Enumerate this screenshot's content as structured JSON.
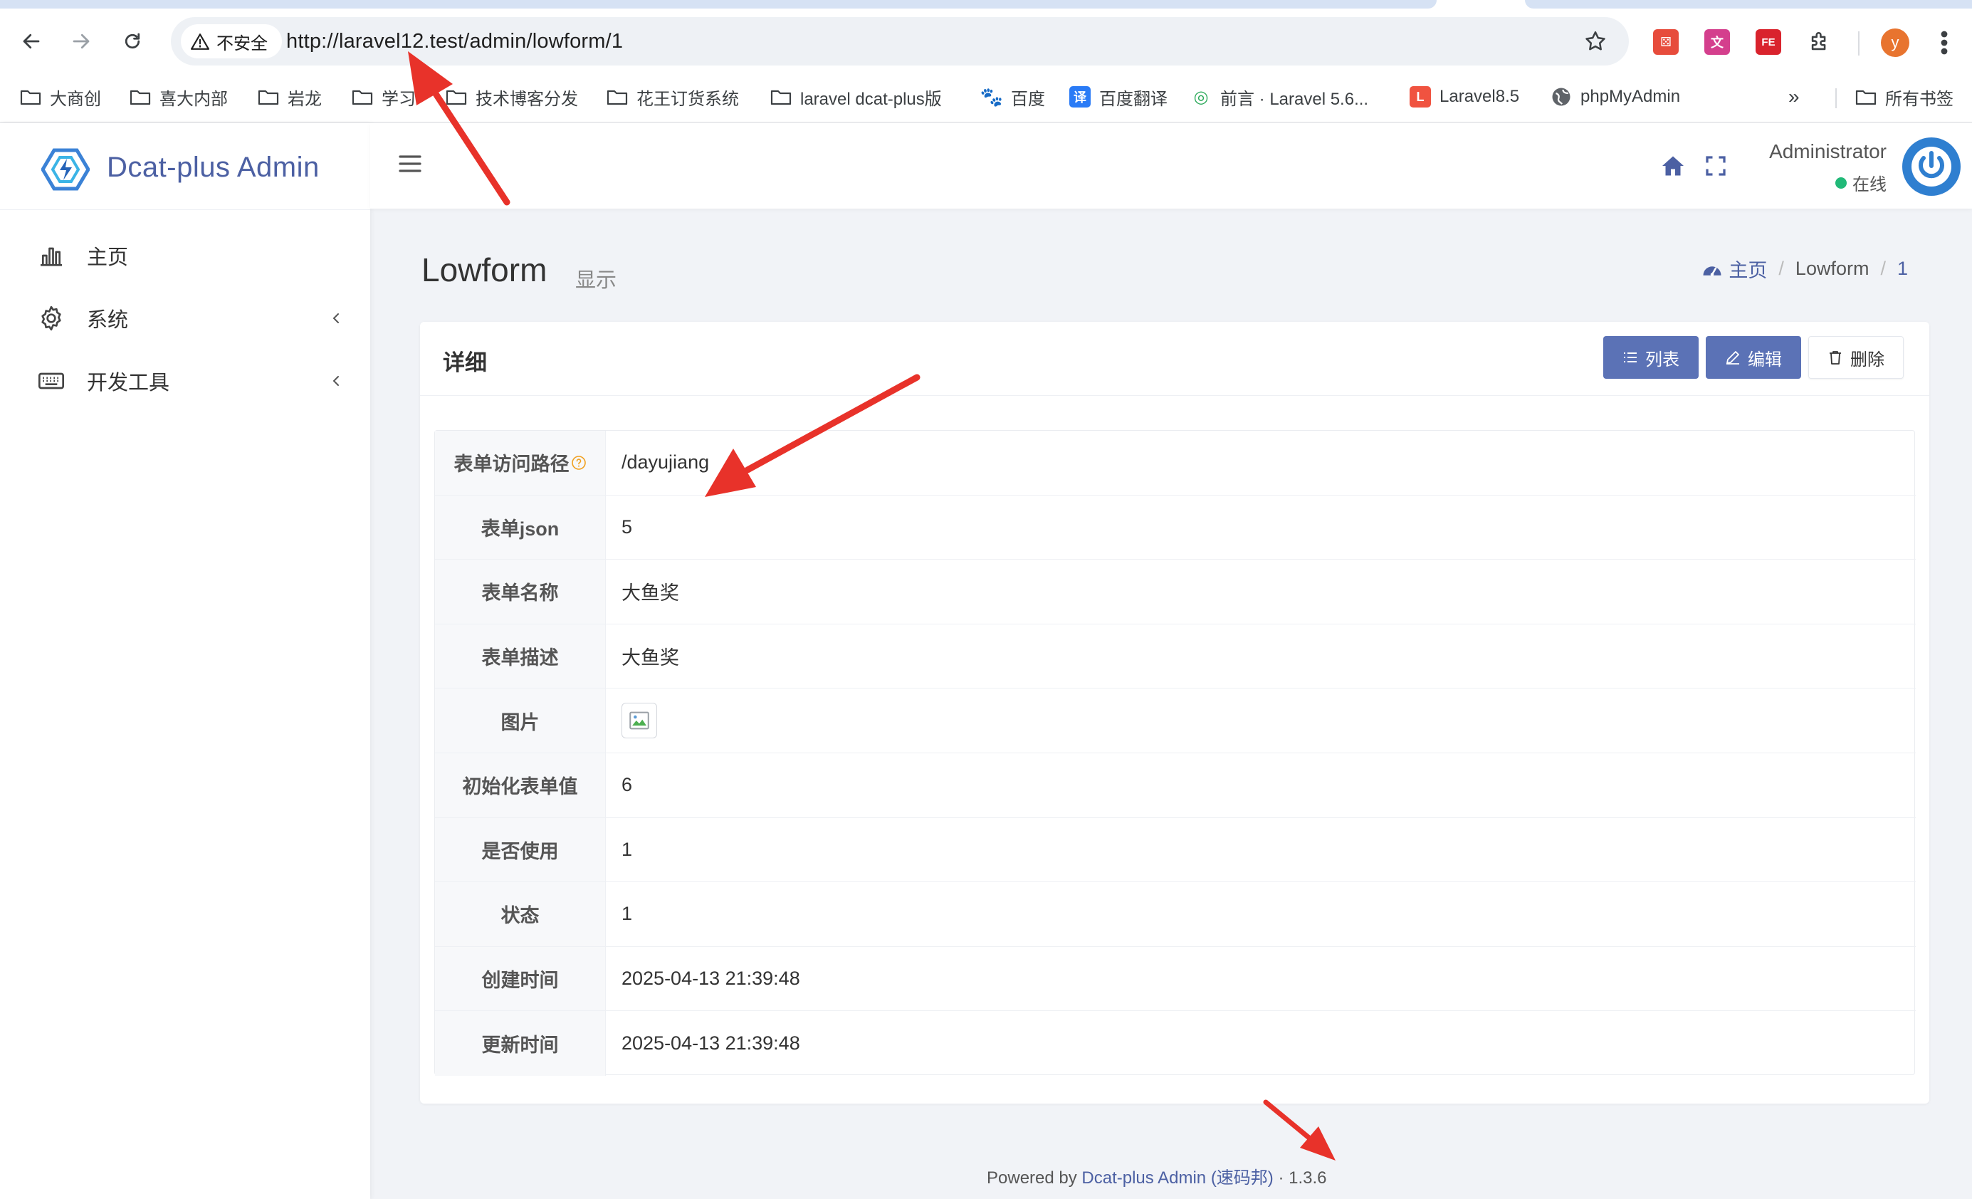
{
  "browser": {
    "security_label": "不安全",
    "url": "http://laravel12.test/admin/lowform/1",
    "profile_initial": "y",
    "bookmarks": [
      {
        "label": "大商创",
        "type": "folder"
      },
      {
        "label": "喜大内部",
        "type": "folder"
      },
      {
        "label": "岩龙",
        "type": "folder"
      },
      {
        "label": "学习",
        "type": "folder"
      },
      {
        "label": "技术博客分发",
        "type": "folder"
      },
      {
        "label": "花王订货系统",
        "type": "folder"
      },
      {
        "label": "laravel dcat-plus版",
        "type": "folder"
      },
      {
        "label": "百度",
        "type": "baidu-icon"
      },
      {
        "label": "百度翻译",
        "type": "translate-icon"
      },
      {
        "label": "前言 · Laravel 5.6...",
        "type": "site-icon"
      },
      {
        "label": "Laravel8.5",
        "type": "laravel-icon"
      },
      {
        "label": "phpMyAdmin",
        "type": "globe-icon"
      }
    ],
    "bookmarks_more": "»",
    "all_bookmarks": "所有书签",
    "extensions": [
      "dice-icon",
      "translate-ext-icon",
      "fe-icon",
      "puzzle-icon"
    ]
  },
  "app": {
    "brand": "Dcat-plus Admin",
    "menu": [
      {
        "label": "主页",
        "icon": "bar-chart-icon",
        "has_children": false
      },
      {
        "label": "系统",
        "icon": "gear-icon",
        "has_children": true
      },
      {
        "label": "开发工具",
        "icon": "keyboard-icon",
        "has_children": true
      }
    ],
    "user": {
      "name": "Administrator",
      "status": "在线"
    }
  },
  "page": {
    "title": "Lowform",
    "subtitle": "显示",
    "breadcrumb": {
      "home": "主页",
      "section": "Lowform",
      "current": "1",
      "sep": "/"
    }
  },
  "card": {
    "title": "详细",
    "buttons": {
      "list": "列表",
      "edit": "编辑",
      "delete": "删除"
    }
  },
  "detail": [
    {
      "key": "表单访问路径",
      "value": "/dayujiang",
      "help": true
    },
    {
      "key": "表单json",
      "value": "5"
    },
    {
      "key": "表单名称",
      "value": "大鱼奖"
    },
    {
      "key": "表单描述",
      "value": "大鱼奖"
    },
    {
      "key": "图片",
      "value": "",
      "image": true
    },
    {
      "key": "初始化表单值",
      "value": "6"
    },
    {
      "key": "是否使用",
      "value": "1"
    },
    {
      "key": "状态",
      "value": "1"
    },
    {
      "key": "创建时间",
      "value": "2025-04-13 21:39:48"
    },
    {
      "key": "更新时间",
      "value": "2025-04-13 21:39:48"
    }
  ],
  "footer": {
    "prefix": "Powered by ",
    "link": "Dcat-plus Admin (速码邦)",
    "sep": " · ",
    "version": "1.3.6"
  },
  "colors": {
    "primary": "#5b72b6",
    "brand": "#4c60a3",
    "online": "#21b978",
    "annotation": "#e8322a"
  }
}
